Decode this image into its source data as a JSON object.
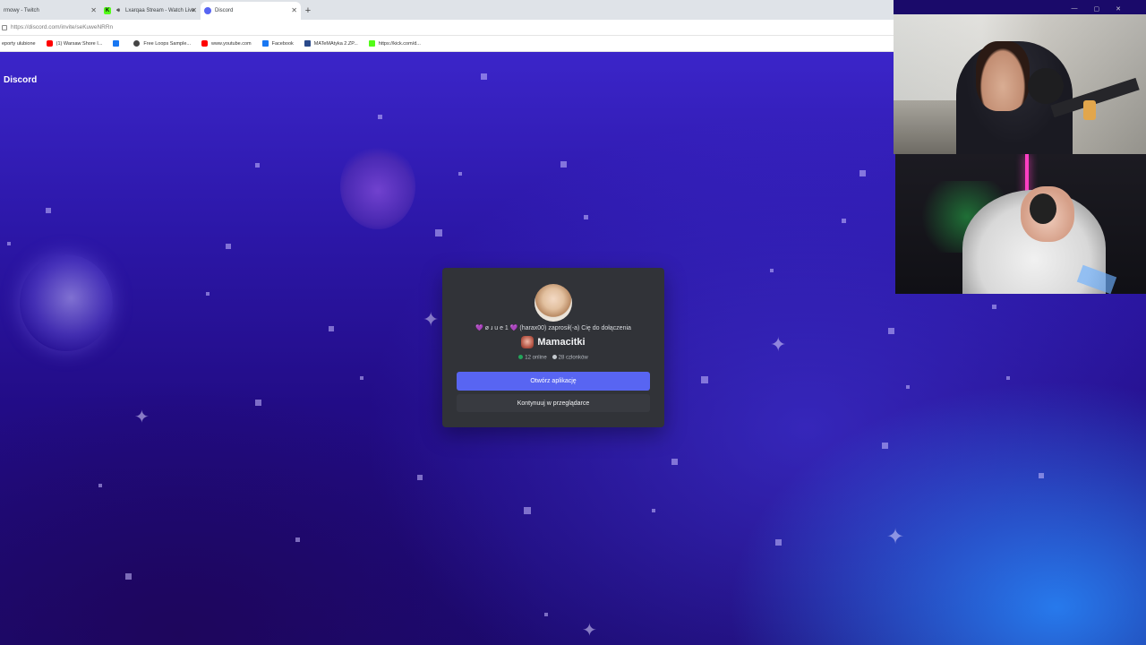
{
  "browser": {
    "tabs": [
      {
        "label": "rmowy - Twitch",
        "icon": "none",
        "active": false
      },
      {
        "label": "Lxarqaa Stream - Watch Live",
        "icon": "kick-icon",
        "active": false
      },
      {
        "label": "Discord",
        "icon": "discord-icon",
        "active": true
      }
    ],
    "new_tab_label": "+",
    "url": "https://discord.com/invite/seKuweNRRn",
    "bookmarks": [
      {
        "label": "eporty ulubione",
        "icon": "none"
      },
      {
        "label": "(1) Warsaw Shore I...",
        "icon": "youtube-icon"
      },
      {
        "label": "",
        "icon": "facebook-icon"
      },
      {
        "label": "Free Loops Sample...",
        "icon": "github-icon"
      },
      {
        "label": "www.youtube.com",
        "icon": "youtube-icon"
      },
      {
        "label": "Facebook",
        "icon": "facebook-icon"
      },
      {
        "label": "MATeMAtyka 2.ZP...",
        "icon": "matematyka-icon"
      },
      {
        "label": "https://kick.com/d...",
        "icon": "kick-icon"
      }
    ]
  },
  "discord": {
    "logo_text": "Discord",
    "invite": {
      "inviter_line": "💜 ø ɹ u e 1 💜 (harax00) zaprosił(-a) Cię do dołączenia",
      "server_name": "Mamacitki",
      "online": "12 online",
      "members": "28 członków",
      "open_app_label": "Otwórz aplikację",
      "continue_browser_label": "Kontynuuj w przeglądarce"
    },
    "colors": {
      "blurple": "#5865f2",
      "modal_bg": "#313338",
      "secondary_button": "#383a40",
      "online_dot": "#23a55a"
    }
  }
}
